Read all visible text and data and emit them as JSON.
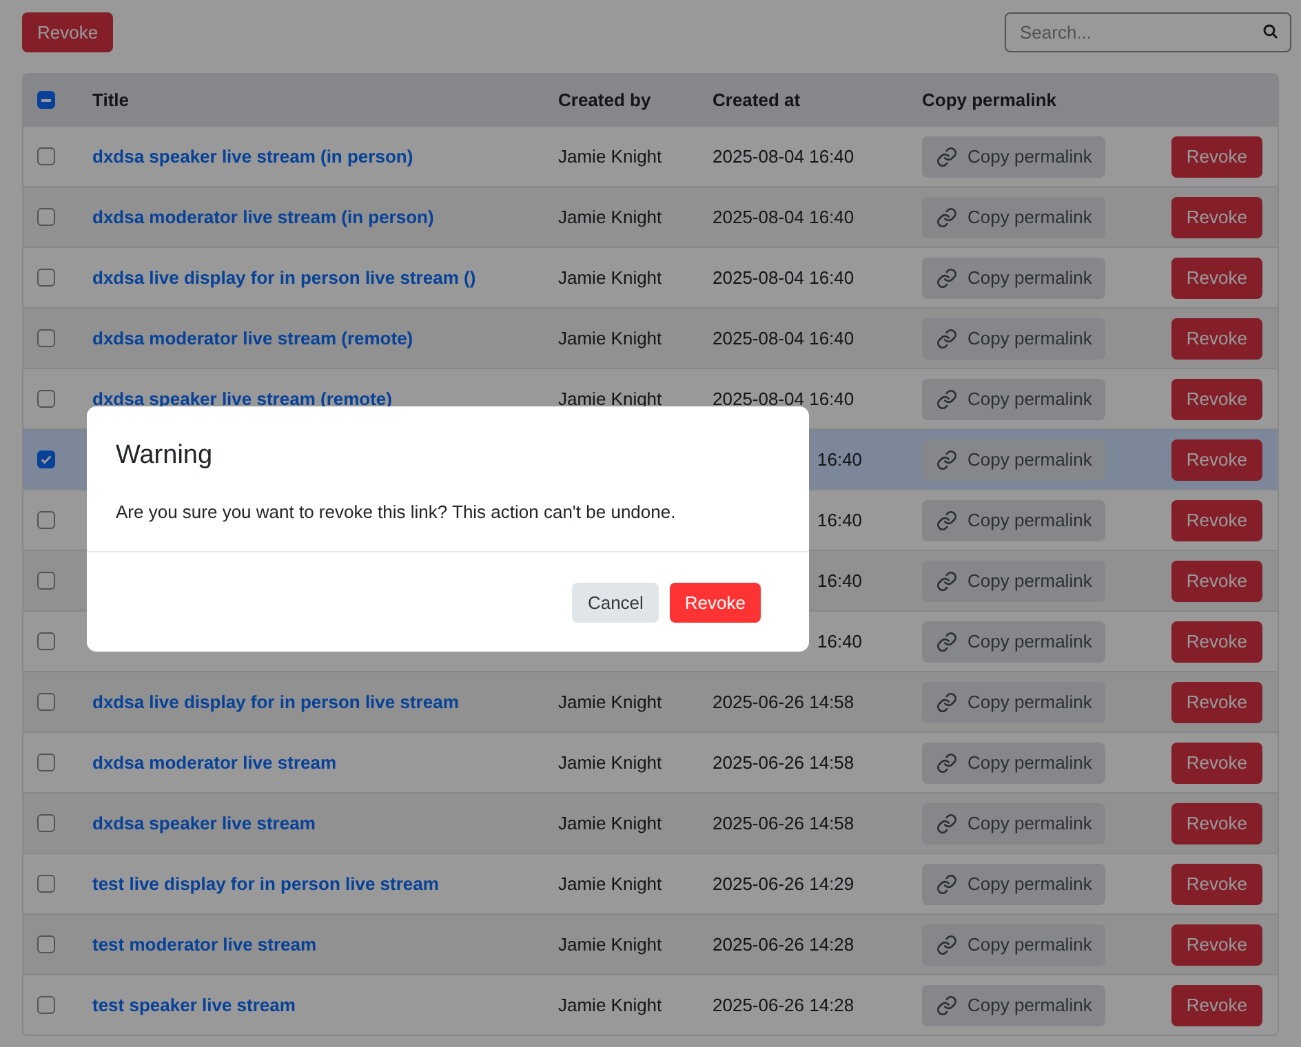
{
  "toolbar": {
    "revoke_button": "Revoke",
    "search": {
      "placeholder": "Search..."
    }
  },
  "table": {
    "select_all": {
      "indeterminate": true
    },
    "columns": [
      "Title",
      "Created by",
      "Created at",
      "Copy permalink"
    ],
    "rows": [
      {
        "kind": "full",
        "checked": false,
        "title": "dxdsa speaker live stream (in person)",
        "created_by": "Jamie Knight",
        "created_at": "2025-08-04 16:40",
        "copy": "Copy permalink",
        "revoke": "Revoke"
      },
      {
        "kind": "full",
        "checked": false,
        "title": "dxdsa moderator live stream (in person)",
        "created_by": "Jamie Knight",
        "created_at": "2025-08-04 16:40",
        "copy": "Copy permalink",
        "revoke": "Revoke"
      },
      {
        "kind": "full",
        "checked": false,
        "title": "dxdsa live display for in person live stream ()",
        "created_by": "Jamie Knight",
        "created_at": "2025-08-04 16:40",
        "copy": "Copy permalink",
        "revoke": "Revoke"
      },
      {
        "kind": "full",
        "checked": false,
        "title": "dxdsa moderator live stream (remote)",
        "created_by": "Jamie Knight",
        "created_at": "2025-08-04 16:40",
        "copy": "Copy permalink",
        "revoke": "Revoke"
      },
      {
        "kind": "full",
        "checked": false,
        "title": "dxdsa speaker live stream (remote)",
        "created_by": "Jamie Knight",
        "created_at": "2025-08-04 16:40",
        "copy": "Copy permalink",
        "revoke": "Revoke"
      },
      {
        "kind": "covered",
        "checked": true,
        "created_at": "16:40",
        "copy": "Copy permalink",
        "revoke": "Revoke"
      },
      {
        "kind": "covered",
        "checked": false,
        "created_at": "16:40",
        "copy": "Copy permalink",
        "revoke": "Revoke"
      },
      {
        "kind": "covered",
        "checked": false,
        "created_at": "16:40",
        "copy": "Copy permalink",
        "revoke": "Revoke"
      },
      {
        "kind": "covered",
        "checked": false,
        "created_at": "16:40",
        "copy": "Copy permalink",
        "revoke": "Revoke"
      },
      {
        "kind": "full",
        "checked": false,
        "title": "dxdsa live display for in person live stream",
        "created_by": "Jamie Knight",
        "created_at": "2025-06-26 14:58",
        "copy": "Copy permalink",
        "revoke": "Revoke"
      },
      {
        "kind": "full",
        "checked": false,
        "title": "dxdsa moderator live stream",
        "created_by": "Jamie Knight",
        "created_at": "2025-06-26 14:58",
        "copy": "Copy permalink",
        "revoke": "Revoke"
      },
      {
        "kind": "full",
        "checked": false,
        "title": "dxdsa speaker live stream",
        "created_by": "Jamie Knight",
        "created_at": "2025-06-26 14:58",
        "copy": "Copy permalink",
        "revoke": "Revoke"
      },
      {
        "kind": "full",
        "checked": false,
        "title": "test live display for in person live stream",
        "created_by": "Jamie Knight",
        "created_at": "2025-06-26 14:29",
        "copy": "Copy permalink",
        "revoke": "Revoke"
      },
      {
        "kind": "full",
        "checked": false,
        "title": "test moderator live stream",
        "created_by": "Jamie Knight",
        "created_at": "2025-06-26 14:28",
        "copy": "Copy permalink",
        "revoke": "Revoke"
      },
      {
        "kind": "full",
        "checked": false,
        "title": "test speaker live stream",
        "created_by": "Jamie Knight",
        "created_at": "2025-06-26 14:28",
        "copy": "Copy permalink",
        "revoke": "Revoke"
      }
    ]
  },
  "modal": {
    "title": "Warning",
    "message": "Are you sure you want to revoke this link? This action can't be undone.",
    "buttons": [
      {
        "kind": "secondary",
        "label": "Cancel"
      },
      {
        "kind": "danger",
        "label": "Revoke"
      }
    ]
  }
}
